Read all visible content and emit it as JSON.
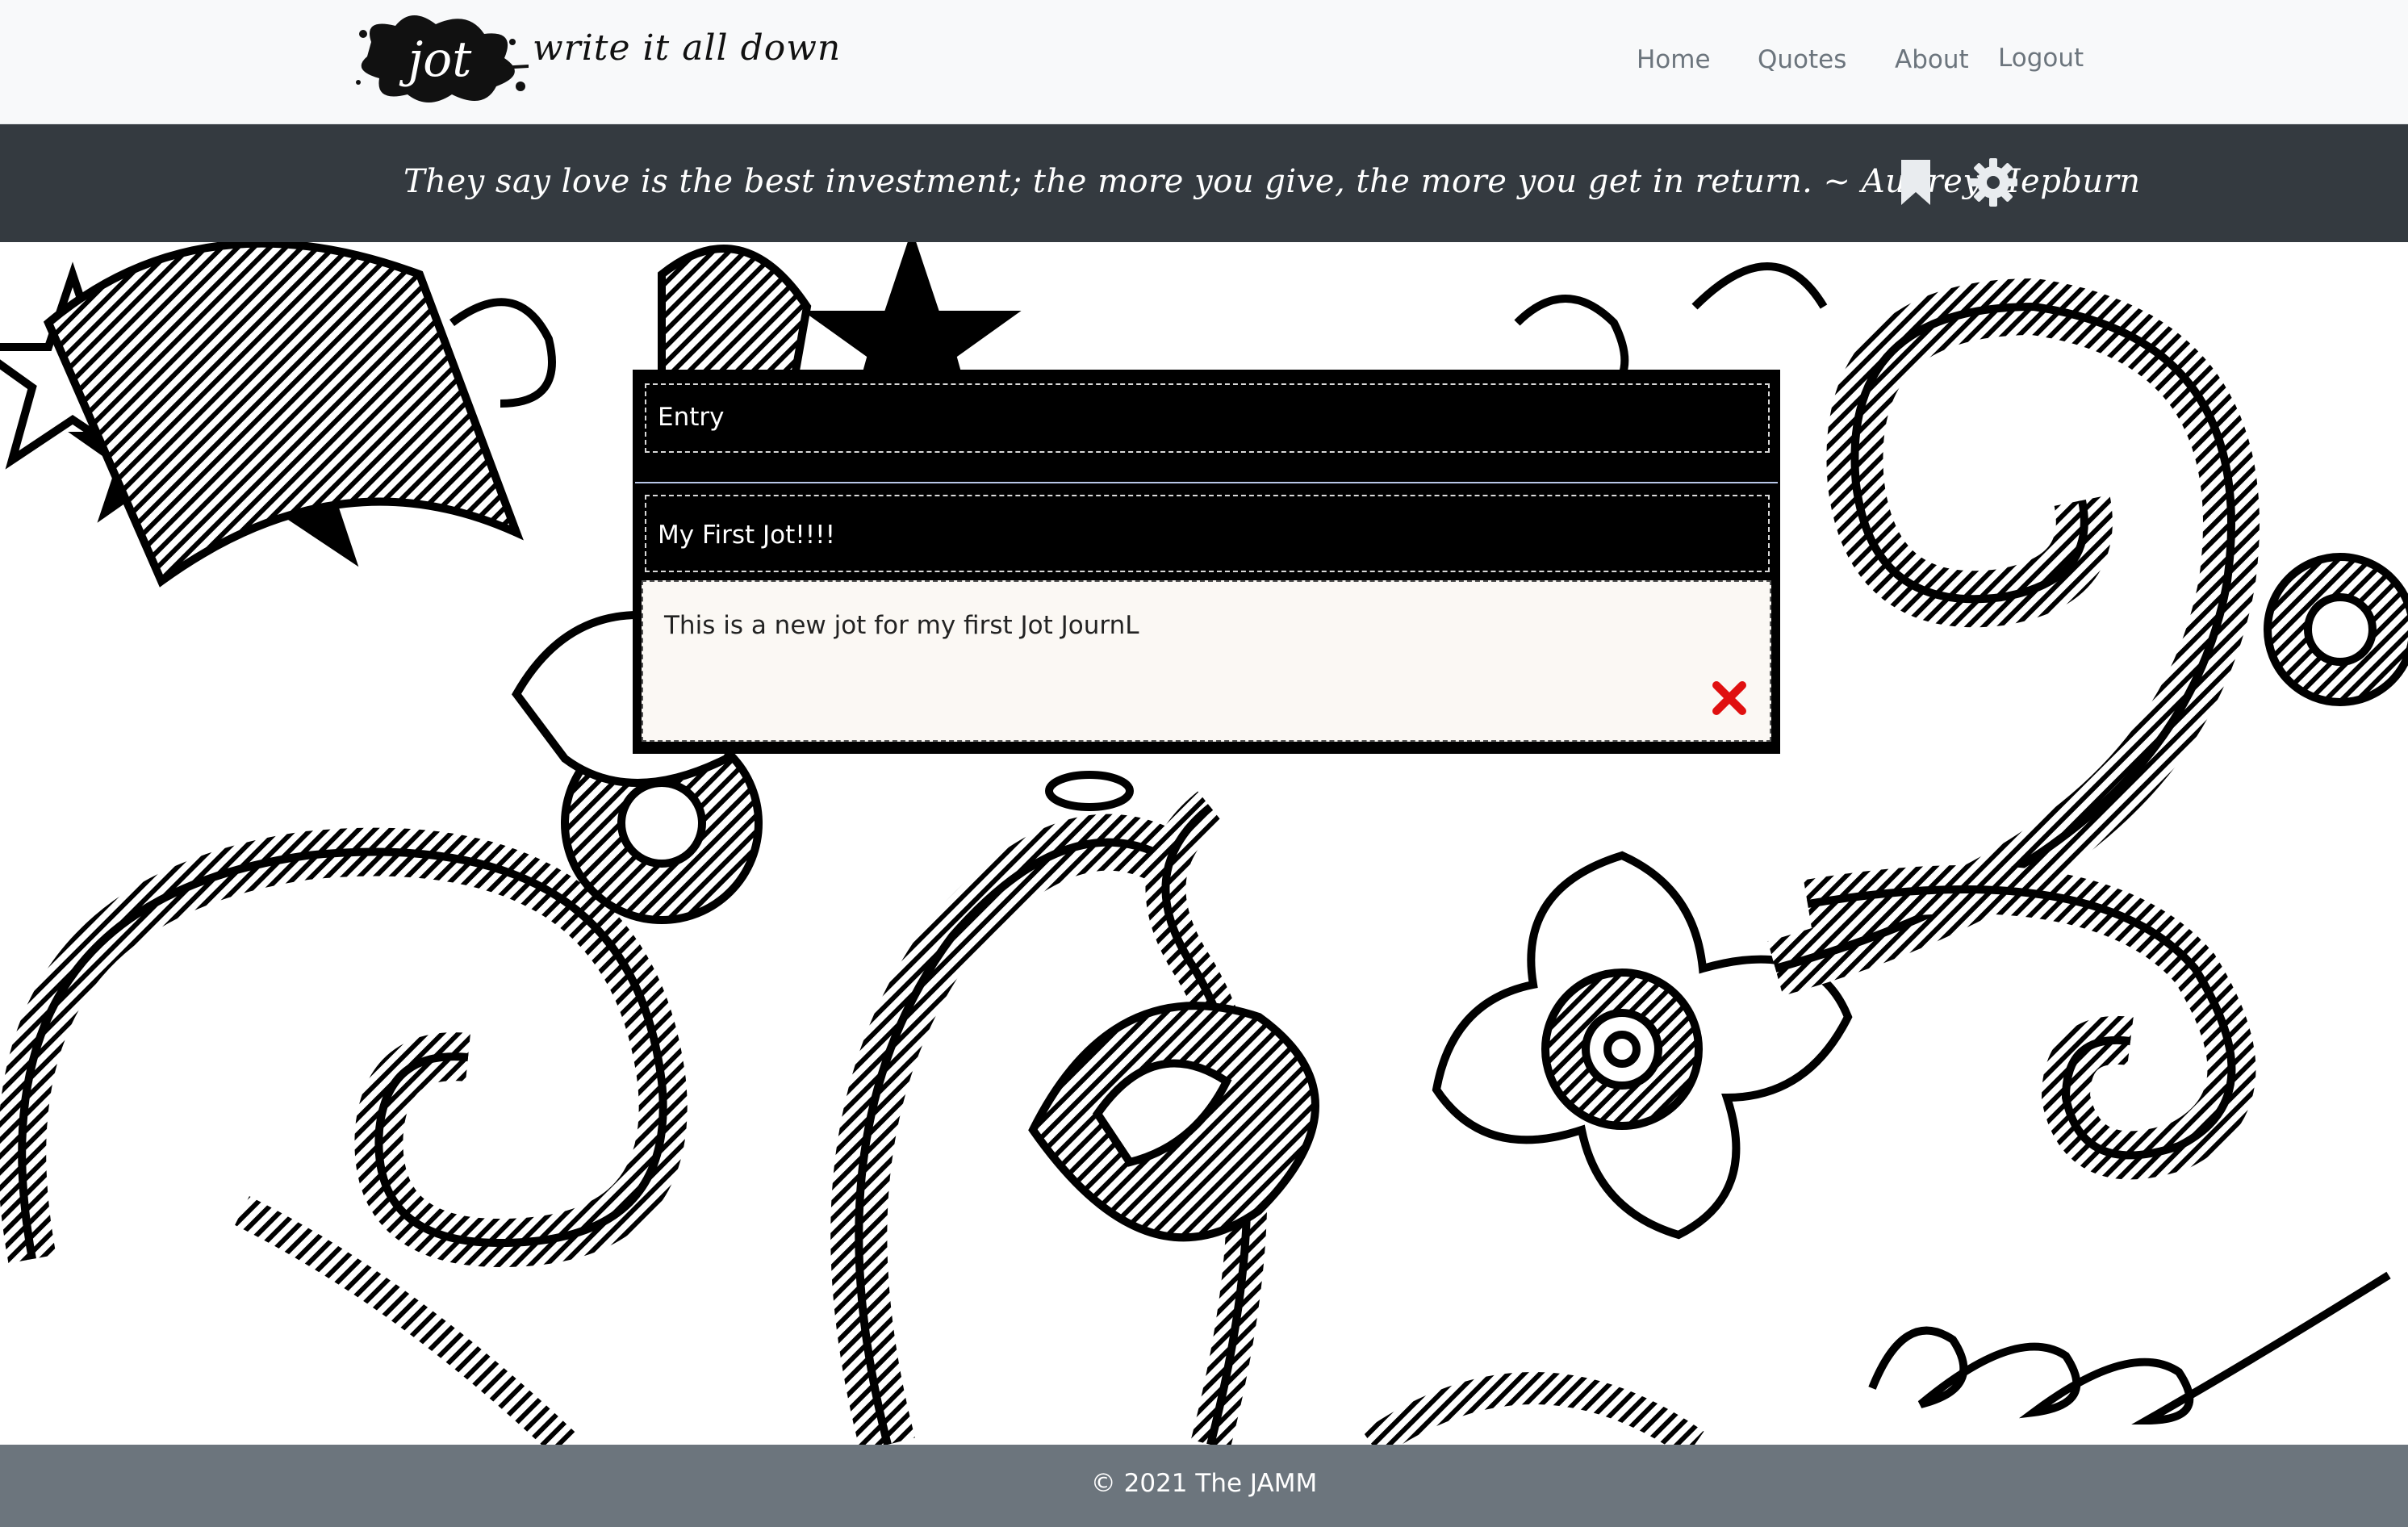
{
  "brand": {
    "logo_text": "jot",
    "tagline": "write it all down"
  },
  "nav": {
    "links": [
      "Home",
      "Quotes",
      "About",
      "Logout"
    ]
  },
  "quote_bar": {
    "quote": "They say love is the best investment; the more you give, the more you get in return. ~ Audrey Hepburn",
    "icons": [
      "bookmark-icon",
      "gear-icon"
    ]
  },
  "entry": {
    "label_value": "Entry",
    "title_value": "My First Jot!!!!",
    "body_text": "This is a new jot for my first Jot JournL",
    "delete_icon": "close-icon"
  },
  "footer": {
    "text": "© 2021 The JAMM"
  },
  "colors": {
    "navbar_bg": "#f8f9fa",
    "quotebar_bg": "#343a40",
    "footer_bg": "#6c757d",
    "delete_red": "#e01010"
  }
}
